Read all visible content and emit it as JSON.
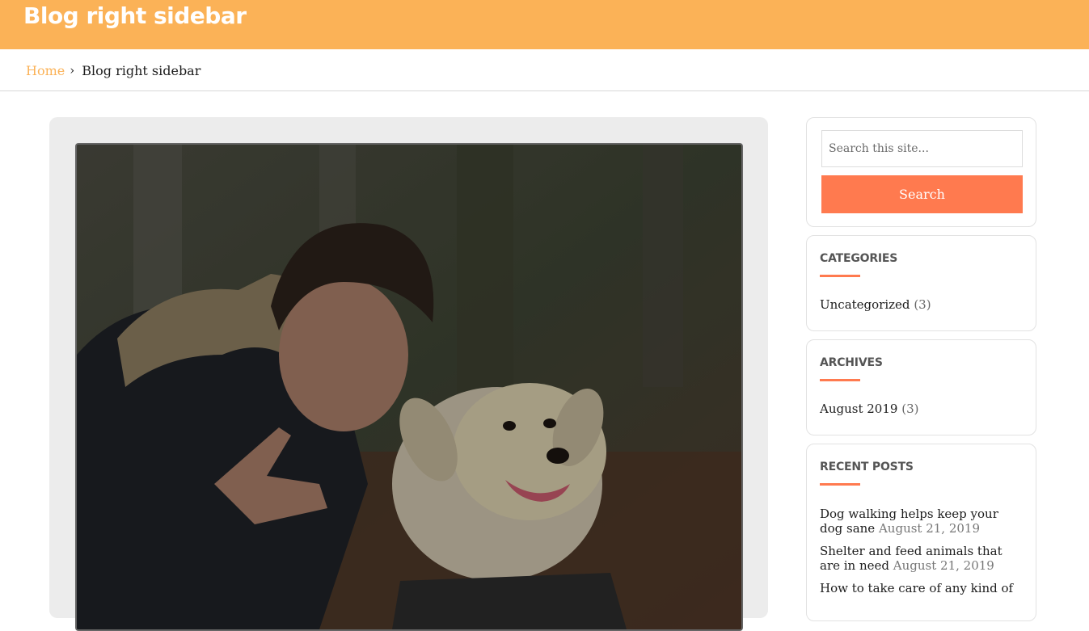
{
  "header": {
    "title": "Blog right sidebar"
  },
  "breadcrumb": {
    "home": "Home",
    "separator": "›",
    "current": "Blog right sidebar"
  },
  "search": {
    "placeholder": "Search this site...",
    "button_label": "Search"
  },
  "categories": {
    "title": "CATEGORIES",
    "items": [
      {
        "label": "Uncategorized",
        "count": "(3)"
      }
    ]
  },
  "archives": {
    "title": "ARCHIVES",
    "items": [
      {
        "label": "August 2019",
        "count": "(3)"
      }
    ]
  },
  "recent_posts": {
    "title": "RECENT POSTS",
    "items": [
      {
        "title": "Dog walking helps keep your dog sane",
        "date": "August 21, 2019"
      },
      {
        "title": "Shelter and feed animals that are in need",
        "date": "August 21, 2019"
      },
      {
        "title": "How to take care of any kind of",
        "date": ""
      }
    ]
  },
  "colors": {
    "header_bg": "#fbb257",
    "accent": "#ff7a4f",
    "link_home": "#fbb257"
  }
}
